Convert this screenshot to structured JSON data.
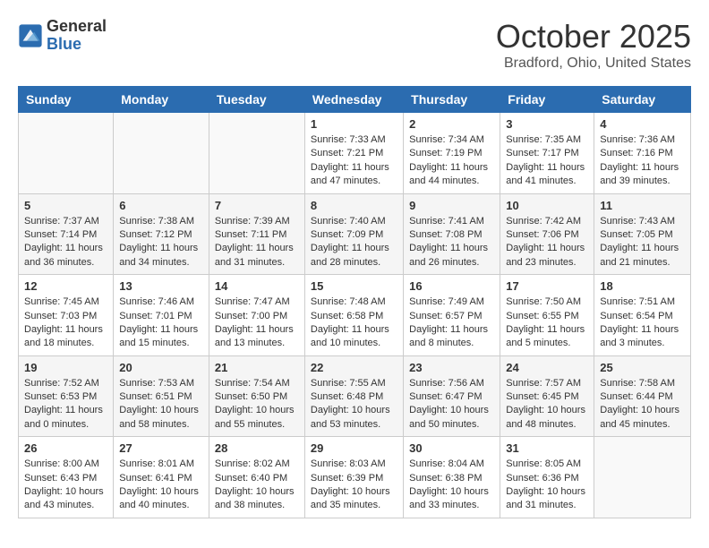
{
  "logo": {
    "general": "General",
    "blue": "Blue"
  },
  "header": {
    "month": "October 2025",
    "location": "Bradford, Ohio, United States"
  },
  "weekdays": [
    "Sunday",
    "Monday",
    "Tuesday",
    "Wednesday",
    "Thursday",
    "Friday",
    "Saturday"
  ],
  "weeks": [
    [
      {
        "day": "",
        "sunrise": "",
        "sunset": "",
        "daylight": ""
      },
      {
        "day": "",
        "sunrise": "",
        "sunset": "",
        "daylight": ""
      },
      {
        "day": "",
        "sunrise": "",
        "sunset": "",
        "daylight": ""
      },
      {
        "day": "1",
        "sunrise": "Sunrise: 7:33 AM",
        "sunset": "Sunset: 7:21 PM",
        "daylight": "Daylight: 11 hours and 47 minutes."
      },
      {
        "day": "2",
        "sunrise": "Sunrise: 7:34 AM",
        "sunset": "Sunset: 7:19 PM",
        "daylight": "Daylight: 11 hours and 44 minutes."
      },
      {
        "day": "3",
        "sunrise": "Sunrise: 7:35 AM",
        "sunset": "Sunset: 7:17 PM",
        "daylight": "Daylight: 11 hours and 41 minutes."
      },
      {
        "day": "4",
        "sunrise": "Sunrise: 7:36 AM",
        "sunset": "Sunset: 7:16 PM",
        "daylight": "Daylight: 11 hours and 39 minutes."
      }
    ],
    [
      {
        "day": "5",
        "sunrise": "Sunrise: 7:37 AM",
        "sunset": "Sunset: 7:14 PM",
        "daylight": "Daylight: 11 hours and 36 minutes."
      },
      {
        "day": "6",
        "sunrise": "Sunrise: 7:38 AM",
        "sunset": "Sunset: 7:12 PM",
        "daylight": "Daylight: 11 hours and 34 minutes."
      },
      {
        "day": "7",
        "sunrise": "Sunrise: 7:39 AM",
        "sunset": "Sunset: 7:11 PM",
        "daylight": "Daylight: 11 hours and 31 minutes."
      },
      {
        "day": "8",
        "sunrise": "Sunrise: 7:40 AM",
        "sunset": "Sunset: 7:09 PM",
        "daylight": "Daylight: 11 hours and 28 minutes."
      },
      {
        "day": "9",
        "sunrise": "Sunrise: 7:41 AM",
        "sunset": "Sunset: 7:08 PM",
        "daylight": "Daylight: 11 hours and 26 minutes."
      },
      {
        "day": "10",
        "sunrise": "Sunrise: 7:42 AM",
        "sunset": "Sunset: 7:06 PM",
        "daylight": "Daylight: 11 hours and 23 minutes."
      },
      {
        "day": "11",
        "sunrise": "Sunrise: 7:43 AM",
        "sunset": "Sunset: 7:05 PM",
        "daylight": "Daylight: 11 hours and 21 minutes."
      }
    ],
    [
      {
        "day": "12",
        "sunrise": "Sunrise: 7:45 AM",
        "sunset": "Sunset: 7:03 PM",
        "daylight": "Daylight: 11 hours and 18 minutes."
      },
      {
        "day": "13",
        "sunrise": "Sunrise: 7:46 AM",
        "sunset": "Sunset: 7:01 PM",
        "daylight": "Daylight: 11 hours and 15 minutes."
      },
      {
        "day": "14",
        "sunrise": "Sunrise: 7:47 AM",
        "sunset": "Sunset: 7:00 PM",
        "daylight": "Daylight: 11 hours and 13 minutes."
      },
      {
        "day": "15",
        "sunrise": "Sunrise: 7:48 AM",
        "sunset": "Sunset: 6:58 PM",
        "daylight": "Daylight: 11 hours and 10 minutes."
      },
      {
        "day": "16",
        "sunrise": "Sunrise: 7:49 AM",
        "sunset": "Sunset: 6:57 PM",
        "daylight": "Daylight: 11 hours and 8 minutes."
      },
      {
        "day": "17",
        "sunrise": "Sunrise: 7:50 AM",
        "sunset": "Sunset: 6:55 PM",
        "daylight": "Daylight: 11 hours and 5 minutes."
      },
      {
        "day": "18",
        "sunrise": "Sunrise: 7:51 AM",
        "sunset": "Sunset: 6:54 PM",
        "daylight": "Daylight: 11 hours and 3 minutes."
      }
    ],
    [
      {
        "day": "19",
        "sunrise": "Sunrise: 7:52 AM",
        "sunset": "Sunset: 6:53 PM",
        "daylight": "Daylight: 11 hours and 0 minutes."
      },
      {
        "day": "20",
        "sunrise": "Sunrise: 7:53 AM",
        "sunset": "Sunset: 6:51 PM",
        "daylight": "Daylight: 10 hours and 58 minutes."
      },
      {
        "day": "21",
        "sunrise": "Sunrise: 7:54 AM",
        "sunset": "Sunset: 6:50 PM",
        "daylight": "Daylight: 10 hours and 55 minutes."
      },
      {
        "day": "22",
        "sunrise": "Sunrise: 7:55 AM",
        "sunset": "Sunset: 6:48 PM",
        "daylight": "Daylight: 10 hours and 53 minutes."
      },
      {
        "day": "23",
        "sunrise": "Sunrise: 7:56 AM",
        "sunset": "Sunset: 6:47 PM",
        "daylight": "Daylight: 10 hours and 50 minutes."
      },
      {
        "day": "24",
        "sunrise": "Sunrise: 7:57 AM",
        "sunset": "Sunset: 6:45 PM",
        "daylight": "Daylight: 10 hours and 48 minutes."
      },
      {
        "day": "25",
        "sunrise": "Sunrise: 7:58 AM",
        "sunset": "Sunset: 6:44 PM",
        "daylight": "Daylight: 10 hours and 45 minutes."
      }
    ],
    [
      {
        "day": "26",
        "sunrise": "Sunrise: 8:00 AM",
        "sunset": "Sunset: 6:43 PM",
        "daylight": "Daylight: 10 hours and 43 minutes."
      },
      {
        "day": "27",
        "sunrise": "Sunrise: 8:01 AM",
        "sunset": "Sunset: 6:41 PM",
        "daylight": "Daylight: 10 hours and 40 minutes."
      },
      {
        "day": "28",
        "sunrise": "Sunrise: 8:02 AM",
        "sunset": "Sunset: 6:40 PM",
        "daylight": "Daylight: 10 hours and 38 minutes."
      },
      {
        "day": "29",
        "sunrise": "Sunrise: 8:03 AM",
        "sunset": "Sunset: 6:39 PM",
        "daylight": "Daylight: 10 hours and 35 minutes."
      },
      {
        "day": "30",
        "sunrise": "Sunrise: 8:04 AM",
        "sunset": "Sunset: 6:38 PM",
        "daylight": "Daylight: 10 hours and 33 minutes."
      },
      {
        "day": "31",
        "sunrise": "Sunrise: 8:05 AM",
        "sunset": "Sunset: 6:36 PM",
        "daylight": "Daylight: 10 hours and 31 minutes."
      },
      {
        "day": "",
        "sunrise": "",
        "sunset": "",
        "daylight": ""
      }
    ]
  ]
}
